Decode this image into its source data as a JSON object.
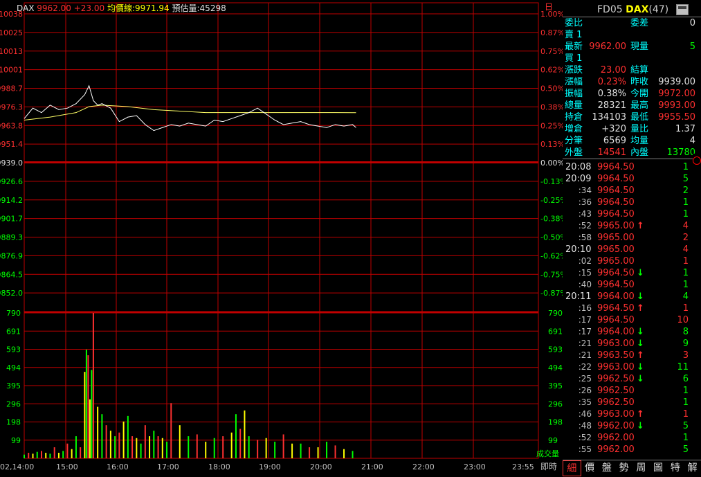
{
  "header": {
    "symbol": "DAX",
    "price_change": "9962.00 +23.00",
    "avg_label": "均價線",
    "avg_value": ":9971.94",
    "est_vol": "預估量:45298"
  },
  "colors": {
    "grid": "#c00000",
    "up": "#ff3030",
    "down": "#00ff00",
    "avg": "#ffff66",
    "price": "#ffffff"
  },
  "axes": {
    "left_price_ticks": [
      "10038",
      "10025",
      "10013",
      "10001",
      "9988.7",
      "9976.3",
      "9963.8",
      "9951.4",
      "9939.0",
      "9926.6",
      "9914.2",
      "9901.7",
      "9889.3",
      "9876.9",
      "9864.5",
      "9852.0"
    ],
    "right_pct_ticks": [
      "1.00%",
      "0.87%",
      "0.75%",
      "0.62%",
      "0.50%",
      "0.38%",
      "0.25%",
      "0.13%",
      "0.00%",
      "-0.13%",
      "-0.25%",
      "-0.38%",
      "-0.50%",
      "-0.62%",
      "-0.75%",
      "-0.87%"
    ],
    "left_vol_ticks": [
      "790",
      "691",
      "593",
      "494",
      "395",
      "296",
      "198",
      "99"
    ],
    "right_vol_ticks": [
      "790",
      "691",
      "593",
      "494",
      "395",
      "296",
      "198",
      "99"
    ],
    "right_vol_label": "成交量",
    "time_ticks": [
      "02,14:00",
      "15:00",
      "16:00",
      "17:00",
      "18:00",
      "19:00",
      "20:00",
      "21:00",
      "22:00",
      "23:00",
      "23:55"
    ],
    "period_label": "日",
    "realtime_label": "即時"
  },
  "chart_data": {
    "type": "line",
    "title": "",
    "ylim": [
      9852.0,
      10038
    ],
    "reference_price": 9939.0,
    "session_start_minutes": 840,
    "session_end_minutes": 1435,
    "price_series": {
      "x_minutes": [
        840,
        850,
        860,
        870,
        880,
        890,
        900,
        910,
        915,
        920,
        925,
        930,
        940,
        950,
        960,
        970,
        980,
        990,
        1000,
        1010,
        1020,
        1030,
        1040,
        1050,
        1060,
        1070,
        1080,
        1090,
        1100,
        1110,
        1120,
        1130,
        1140,
        1150,
        1160,
        1170,
        1180,
        1190,
        1200,
        1210,
        1220,
        1224
      ],
      "values": [
        9968,
        9975,
        9972,
        9977,
        9974,
        9975,
        9978,
        9984,
        9990,
        9980,
        9977,
        9978,
        9975,
        9966,
        9969,
        9970,
        9964,
        9960,
        9962,
        9964,
        9963,
        9965,
        9964,
        9963,
        9967,
        9966,
        9968,
        9970,
        9972,
        9975,
        9971,
        9967,
        9964,
        9965,
        9966,
        9964,
        9963,
        9962,
        9964,
        9963,
        9964,
        9962
      ]
    },
    "avg_series": {
      "x_minutes": [
        840,
        870,
        900,
        915,
        930,
        960,
        990,
        1020,
        1050,
        1080,
        1110,
        1140,
        1170,
        1200,
        1224
      ],
      "values": [
        9967,
        9969,
        9972,
        9976,
        9977,
        9976,
        9974,
        9973,
        9972,
        9972,
        9972,
        9972,
        9972,
        9972,
        9971.94
      ]
    },
    "volume_series": {
      "x_minutes": [
        840,
        845,
        850,
        855,
        860,
        865,
        870,
        875,
        880,
        885,
        890,
        895,
        900,
        905,
        910,
        912,
        914,
        916,
        918,
        920,
        925,
        930,
        935,
        940,
        945,
        950,
        955,
        960,
        965,
        970,
        975,
        980,
        985,
        990,
        995,
        1000,
        1005,
        1010,
        1020,
        1030,
        1040,
        1050,
        1060,
        1070,
        1080,
        1085,
        1090,
        1095,
        1100,
        1110,
        1120,
        1130,
        1140,
        1150,
        1160,
        1170,
        1180,
        1190,
        1200,
        1210,
        1220
      ],
      "values": [
        20,
        30,
        25,
        35,
        40,
        30,
        25,
        60,
        30,
        40,
        80,
        50,
        120,
        60,
        470,
        590,
        560,
        320,
        480,
        790,
        280,
        240,
        180,
        150,
        120,
        140,
        200,
        230,
        120,
        110,
        80,
        180,
        120,
        150,
        120,
        110,
        90,
        300,
        180,
        120,
        130,
        90,
        110,
        120,
        140,
        240,
        160,
        260,
        120,
        100,
        110,
        90,
        130,
        80,
        80,
        60,
        60,
        90,
        70,
        50,
        40
      ],
      "ylim": [
        0,
        790
      ]
    }
  },
  "panel": {
    "code": "FD05",
    "name": "DAX",
    "count": "(47)",
    "quote": {
      "row1": {
        "l": "委比",
        "l2": "委差",
        "v2": "0"
      },
      "row2": {
        "l": "賣 1"
      },
      "row3": {
        "l": "最新",
        "v": "9962.00",
        "l2": "現量",
        "v2": "5"
      },
      "row4": {
        "l": "買 1"
      },
      "rows": [
        {
          "l": "漲跌",
          "v": "23.00",
          "vc": "red",
          "l2": "結算",
          "v2": "",
          "v2c": "white"
        },
        {
          "l": "漲幅",
          "v": "0.23%",
          "vc": "red",
          "l2": "昨收",
          "v2": "9939.00",
          "v2c": "white"
        },
        {
          "l": "振幅",
          "v": "0.38%",
          "vc": "white",
          "l2": "今開",
          "v2": "9972.00",
          "v2c": "red"
        },
        {
          "l": "總量",
          "v": "28321",
          "vc": "white",
          "l2": "最高",
          "v2": "9993.00",
          "v2c": "red"
        },
        {
          "l": "持倉",
          "v": "134103",
          "vc": "white",
          "l2": "最低",
          "v2": "9955.50",
          "v2c": "red"
        },
        {
          "l": "增倉",
          "v": "+320",
          "vc": "white",
          "l2": "量比",
          "v2": "1.37",
          "v2c": "white"
        },
        {
          "l": "分筆",
          "v": "6569",
          "vc": "white",
          "l2": "均量",
          "v2": "4",
          "v2c": "white"
        }
      ],
      "outer": {
        "l": "外盤",
        "v": "14541",
        "l2": "內盤",
        "v2": "13780"
      }
    },
    "ticks": [
      {
        "t": "20:08",
        "p": "9964.50",
        "a": "",
        "q": "1",
        "qc": "green"
      },
      {
        "t": "20:09",
        "p": "9964.50",
        "a": "",
        "q": "5",
        "qc": "green"
      },
      {
        "t": ":34",
        "p": "9964.50",
        "a": "",
        "q": "2",
        "qc": "green"
      },
      {
        "t": ":36",
        "p": "9964.50",
        "a": "",
        "q": "1",
        "qc": "green"
      },
      {
        "t": ":43",
        "p": "9964.50",
        "a": "",
        "q": "1",
        "qc": "green"
      },
      {
        "t": ":52",
        "p": "9965.00",
        "a": "↑",
        "ac": "red",
        "q": "4",
        "qc": "red"
      },
      {
        "t": ":58",
        "p": "9965.00",
        "a": "",
        "q": "2",
        "qc": "red"
      },
      {
        "t": "20:10",
        "p": "9965.00",
        "a": "",
        "q": "4",
        "qc": "red"
      },
      {
        "t": ":02",
        "p": "9965.00",
        "a": "",
        "q": "1",
        "qc": "red"
      },
      {
        "t": ":15",
        "p": "9964.50",
        "a": "↓",
        "ac": "green",
        "q": "1",
        "qc": "green"
      },
      {
        "t": ":40",
        "p": "9964.50",
        "a": "",
        "q": "1",
        "qc": "green"
      },
      {
        "t": "20:11",
        "p": "9964.00",
        "a": "↓",
        "ac": "green",
        "q": "4",
        "qc": "green"
      },
      {
        "t": ":16",
        "p": "9964.50",
        "a": "↑",
        "ac": "red",
        "q": "1",
        "qc": "red"
      },
      {
        "t": ":17",
        "p": "9964.50",
        "a": "",
        "q": "10",
        "qc": "red"
      },
      {
        "t": ":17",
        "p": "9964.00",
        "a": "↓",
        "ac": "green",
        "q": "8",
        "qc": "green"
      },
      {
        "t": ":21",
        "p": "9963.00",
        "a": "↓",
        "ac": "green",
        "q": "9",
        "qc": "green"
      },
      {
        "t": ":21",
        "p": "9963.50",
        "a": "↑",
        "ac": "red",
        "q": "3",
        "qc": "red"
      },
      {
        "t": ":22",
        "p": "9963.00",
        "a": "↓",
        "ac": "green",
        "q": "11",
        "qc": "green"
      },
      {
        "t": ":25",
        "p": "9962.50",
        "a": "↓",
        "ac": "green",
        "q": "6",
        "qc": "green"
      },
      {
        "t": ":26",
        "p": "9962.50",
        "a": "",
        "q": "1",
        "qc": "green"
      },
      {
        "t": ":35",
        "p": "9962.50",
        "a": "",
        "q": "1",
        "qc": "green"
      },
      {
        "t": ":46",
        "p": "9963.00",
        "a": "↑",
        "ac": "red",
        "q": "1",
        "qc": "red"
      },
      {
        "t": ":48",
        "p": "9962.00",
        "a": "↓",
        "ac": "green",
        "q": "5",
        "qc": "green"
      },
      {
        "t": ":52",
        "p": "9962.00",
        "a": "",
        "q": "1",
        "qc": "green"
      },
      {
        "t": ":55",
        "p": "9962.00",
        "a": "",
        "q": "5",
        "qc": "green"
      }
    ],
    "tabs": [
      "細",
      "價",
      "盤",
      "勢",
      "周",
      "圖",
      "特",
      "解"
    ]
  }
}
